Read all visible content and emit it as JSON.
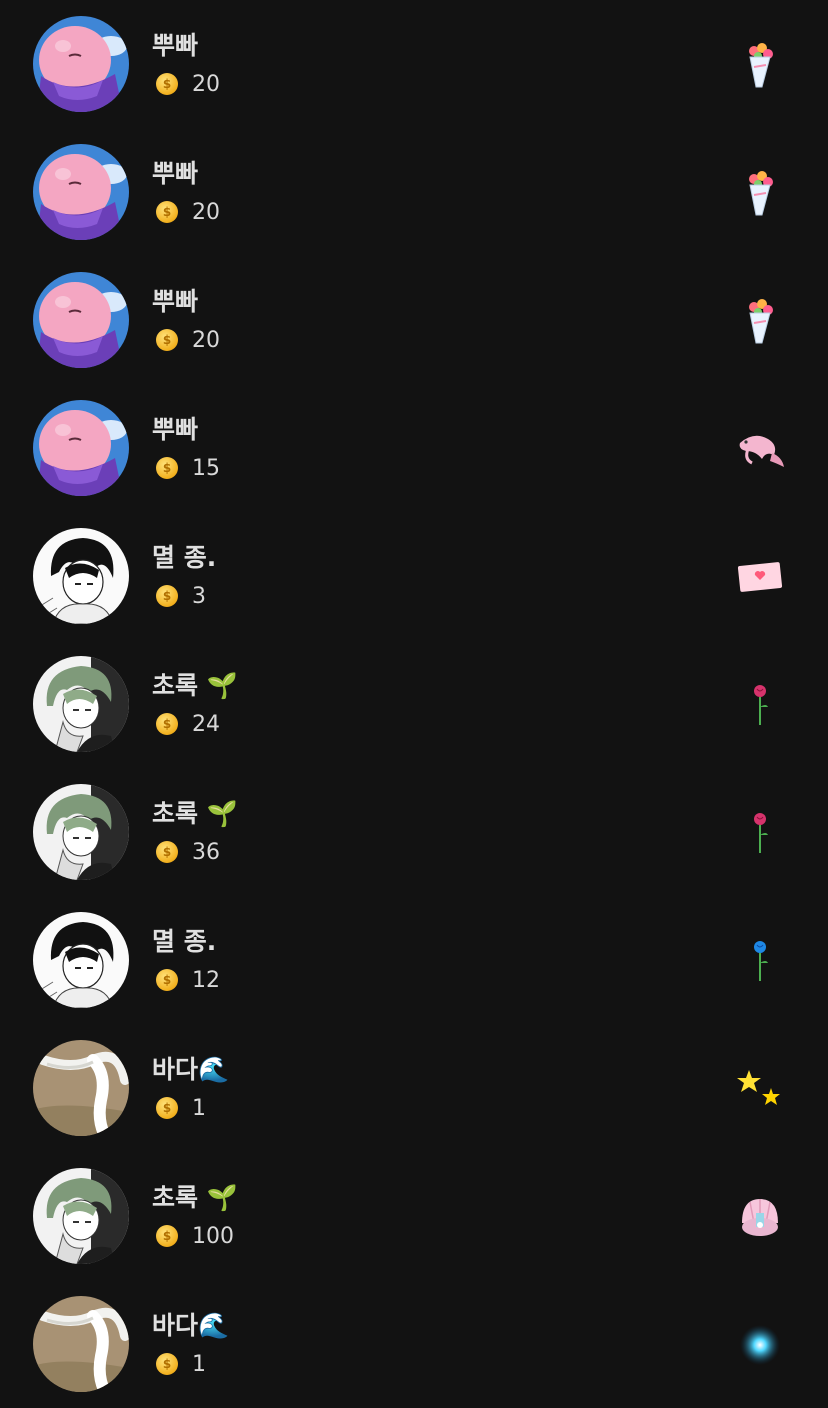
{
  "rows": [
    {
      "name": "뿌빠",
      "coins": "20",
      "avatar": "pink-character-avatar",
      "gift": "bouquet-icon"
    },
    {
      "name": "뿌빠",
      "coins": "20",
      "avatar": "pink-character-avatar",
      "gift": "bouquet-icon"
    },
    {
      "name": "뿌빠",
      "coins": "20",
      "avatar": "pink-character-avatar",
      "gift": "bouquet-icon"
    },
    {
      "name": "뿌빠",
      "coins": "15",
      "avatar": "pink-character-avatar",
      "gift": "koi-fish-icon"
    },
    {
      "name": "멸 종.",
      "coins": "3",
      "avatar": "manga-boy-avatar",
      "gift": "love-letter-icon"
    },
    {
      "name": "초록 🌱",
      "coins": "24",
      "avatar": "green-hair-avatar",
      "gift": "red-rose-icon"
    },
    {
      "name": "초록 🌱",
      "coins": "36",
      "avatar": "green-hair-avatar",
      "gift": "red-rose-icon"
    },
    {
      "name": "멸 종.",
      "coins": "12",
      "avatar": "manga-boy-avatar",
      "gift": "blue-rose-icon"
    },
    {
      "name": "바다🌊",
      "coins": "1",
      "avatar": "white-yarn-avatar",
      "gift": "stars-icon"
    },
    {
      "name": "초록 🌱",
      "coins": "100",
      "avatar": "green-hair-avatar",
      "gift": "seashell-castle-icon"
    },
    {
      "name": "바다🌊",
      "coins": "1",
      "avatar": "white-yarn-avatar",
      "gift": "sparkle-icon"
    }
  ],
  "coin_symbol": "$",
  "colors": {
    "background": "#121212",
    "coin": "#f2b01e",
    "text": "#e0e0e0"
  }
}
